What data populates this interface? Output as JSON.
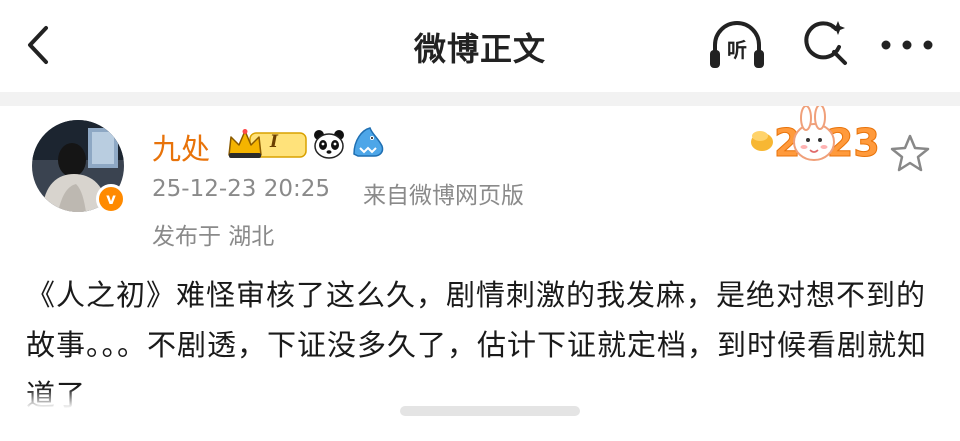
{
  "header": {
    "title": "微博正文",
    "listen_label": "听"
  },
  "post": {
    "author": {
      "name": "九处",
      "level": "I",
      "verified_mark": "v"
    },
    "timestamp": "25-12-23 20:25",
    "source": "来自微博网页版",
    "location": "发布于 湖北",
    "decoration_text": "2023",
    "content": "《人之初》难怪审核了这么久，剧情刺激的我发麻，是绝对想不到的故事。。。不剧透，下证没多久了，估计下证就定档，到时候看剧就知道了"
  },
  "icons": {
    "back": "chevron-left-icon",
    "listen": "headphones-icon",
    "search": "search-refresh-icon",
    "more": "more-dots-icon",
    "star": "star-outline-icon",
    "crown": "crown-icon",
    "panda": "panda-icon",
    "shark": "shark-icon"
  },
  "colors": {
    "username": "#e8730a",
    "meta_text": "#8a8a8a",
    "verified_badge": "#ff8a00",
    "crown_gold": "#f5b400",
    "divider": "#f2f2f2"
  }
}
